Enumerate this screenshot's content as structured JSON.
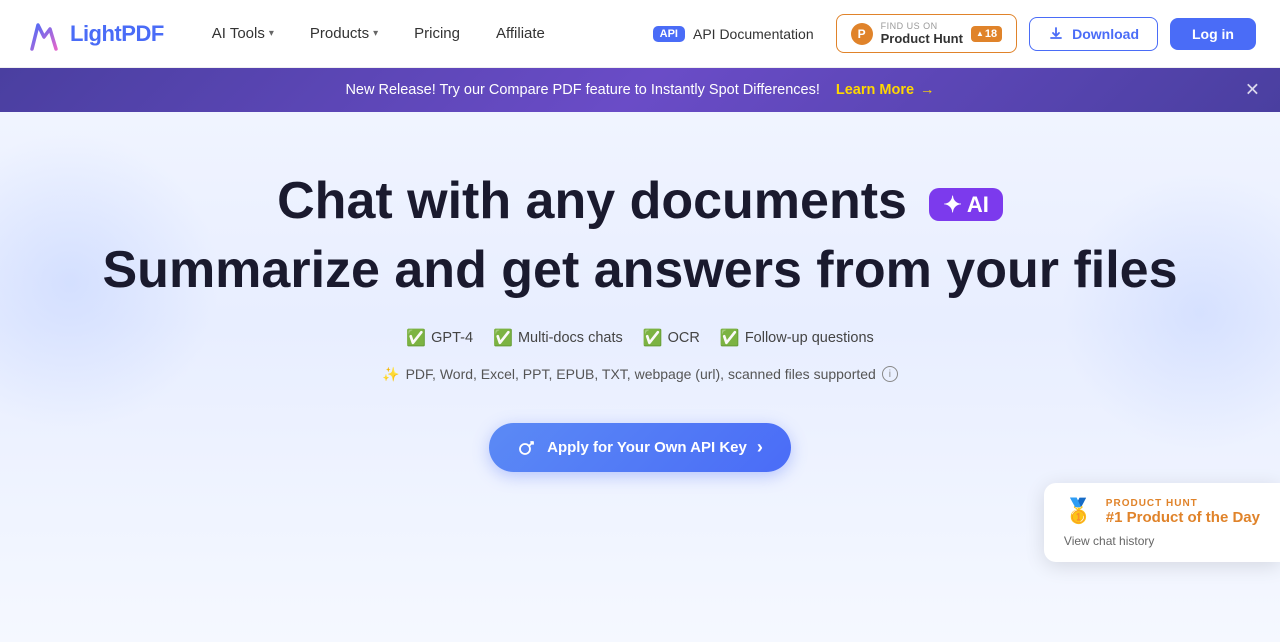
{
  "navbar": {
    "logo_text_light": "Light",
    "logo_text_pdf": "PDF",
    "nav_items": [
      {
        "label": "AI Tools",
        "has_dropdown": true
      },
      {
        "label": "Products",
        "has_dropdown": true
      },
      {
        "label": "Pricing",
        "has_dropdown": false
      },
      {
        "label": "Affiliate",
        "has_dropdown": false
      }
    ],
    "api_badge_label": "API",
    "api_doc_label": "API Documentation",
    "product_hunt_find": "FIND US ON",
    "product_hunt_name": "Product Hunt",
    "product_hunt_count": "18",
    "product_hunt_arrow": "▲",
    "download_label": "Download",
    "login_label": "Log in"
  },
  "banner": {
    "text": "New Release! Try our Compare PDF feature to Instantly Spot Differences!",
    "link_label": "Learn More",
    "link_arrow": "→",
    "close_symbol": "✕"
  },
  "hero": {
    "title_line1": "Chat with any documents",
    "ai_badge_icon": "✦",
    "ai_badge_label": "AI",
    "title_line2": "Summarize and get answers from your files",
    "features": [
      {
        "icon": "✅",
        "label": "GPT-4"
      },
      {
        "icon": "✅",
        "label": "Multi-docs chats"
      },
      {
        "icon": "✅",
        "label": "OCR"
      },
      {
        "icon": "✅",
        "label": "Follow-up questions"
      }
    ],
    "formats_icon": "✨",
    "formats_text": "PDF, Word, Excel, PPT, EPUB, TXT, webpage (url), scanned files supported",
    "info_icon": "i",
    "api_btn_label": "Apply for Your Own API Key",
    "api_btn_arrow": "›"
  },
  "product_hunt_card": {
    "medal": "🥇",
    "label": "PRODUCT HUNT",
    "title": "#1 Product of the Day",
    "link": "View chat history"
  }
}
